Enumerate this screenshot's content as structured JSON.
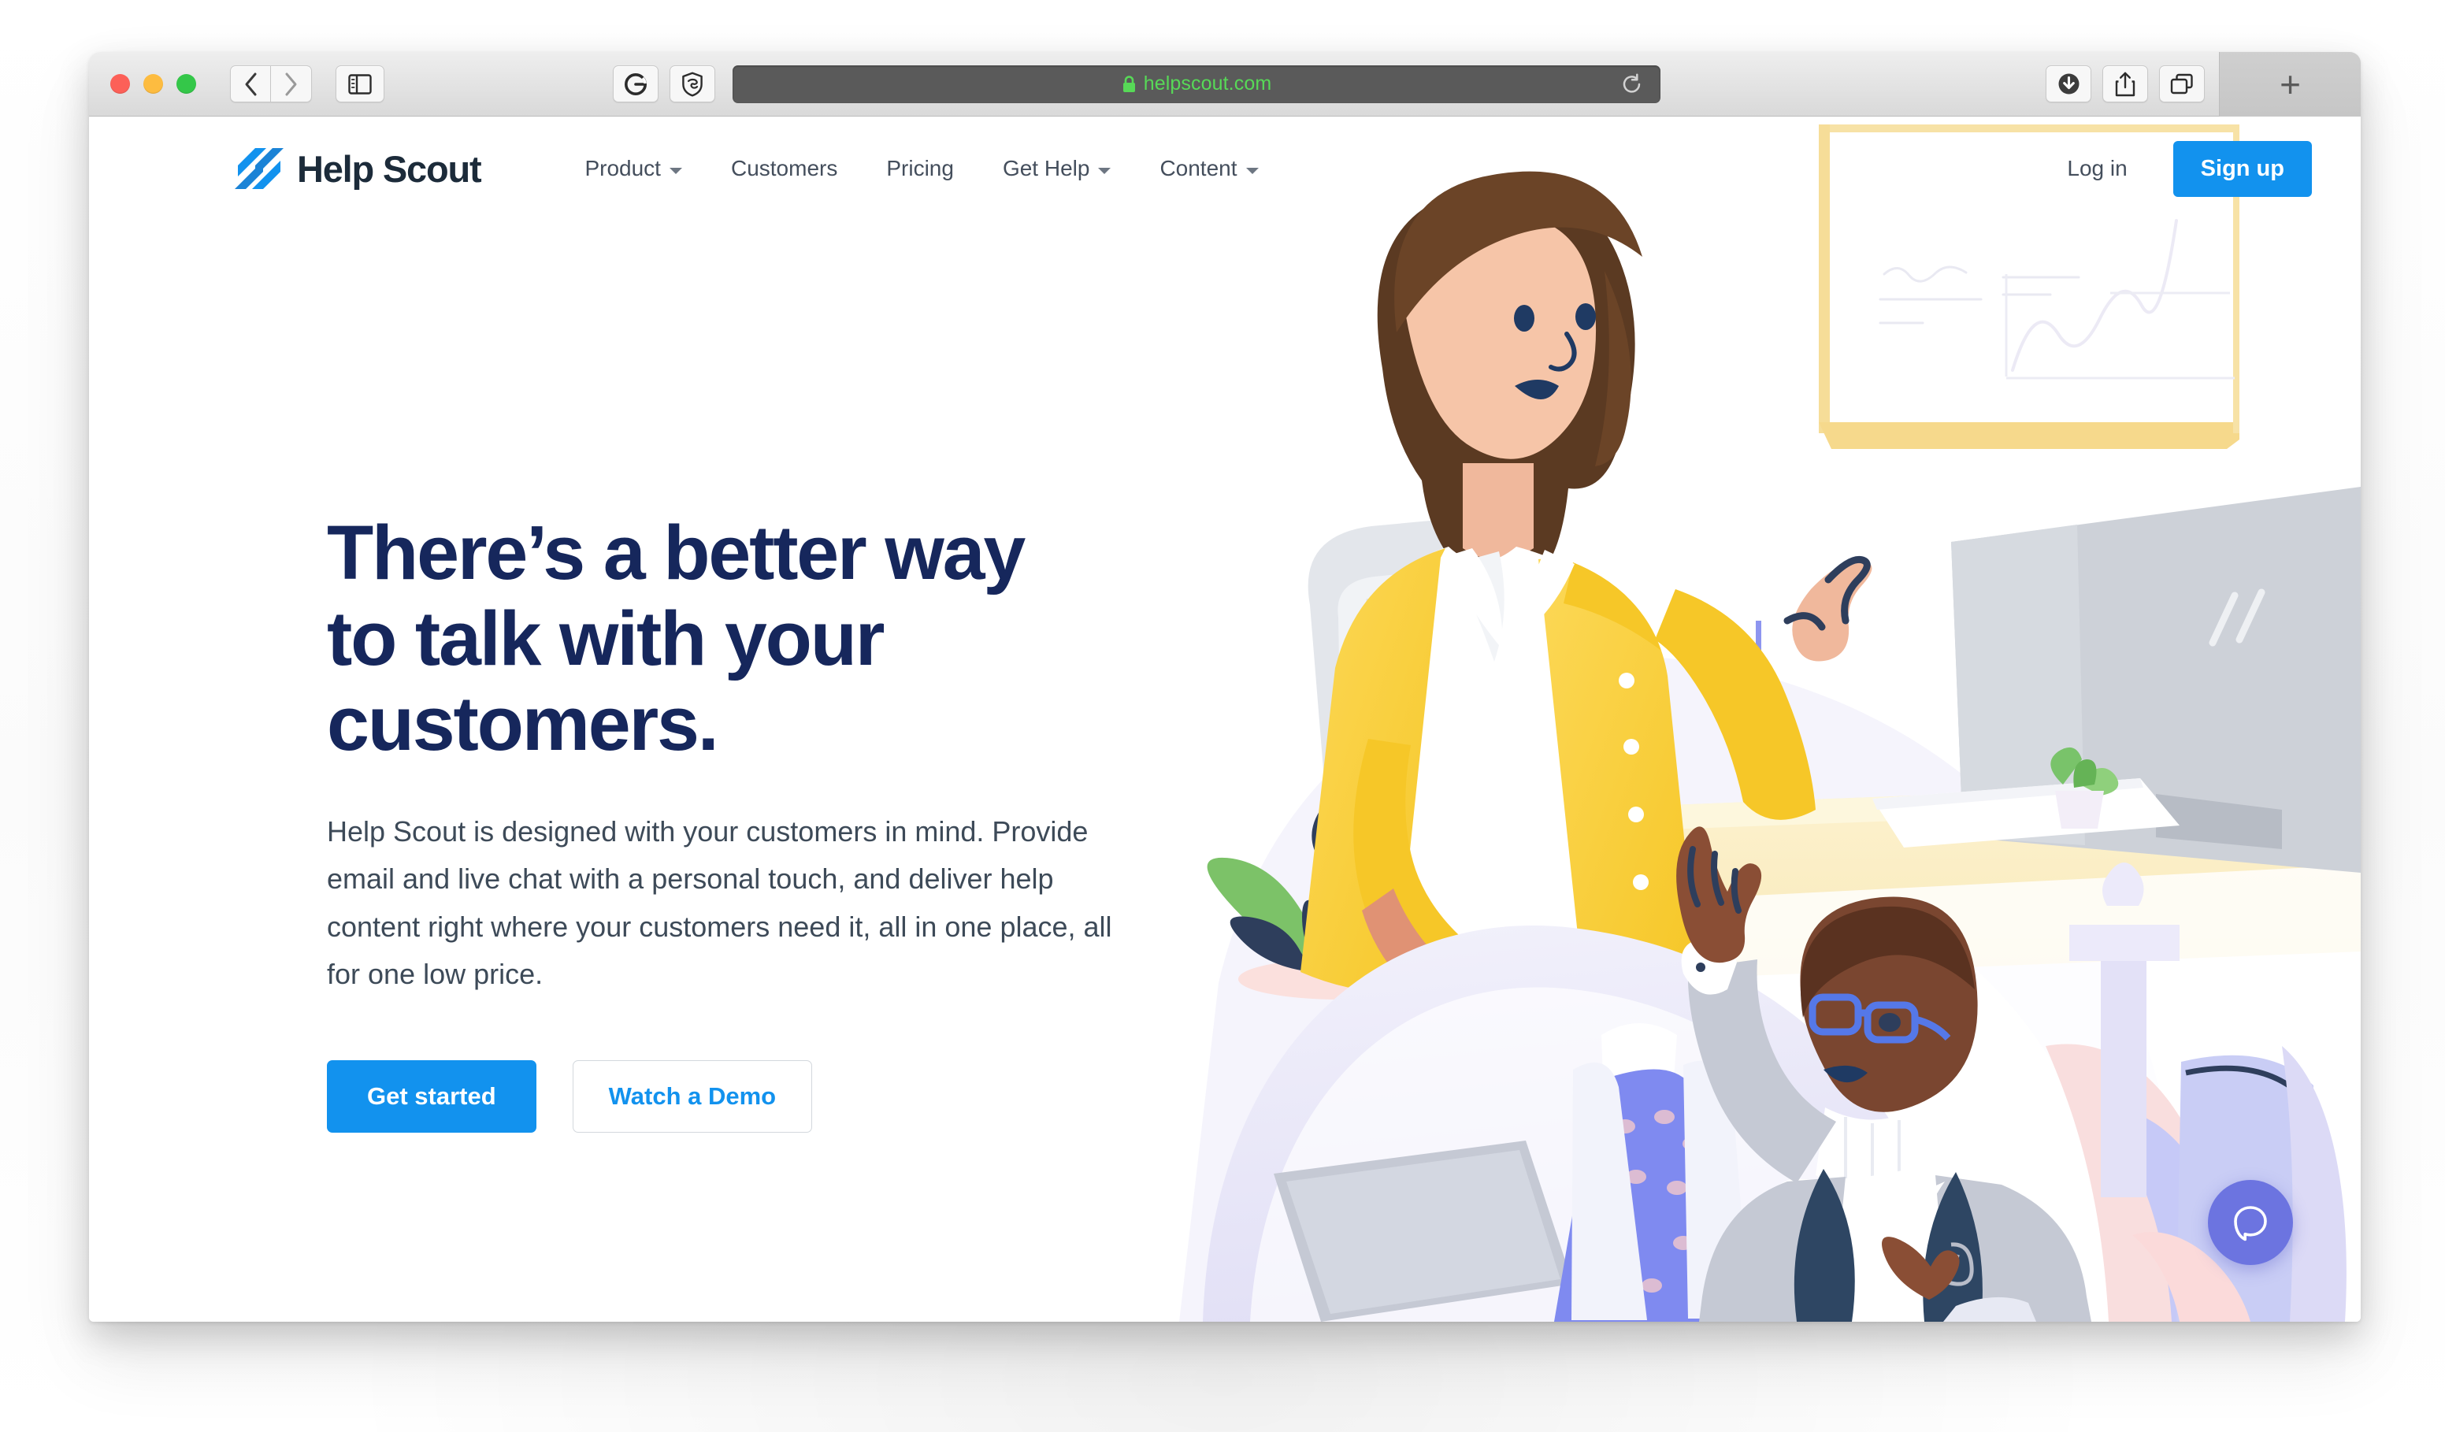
{
  "browser": {
    "traffic_lights": [
      "close",
      "minimize",
      "maximize"
    ],
    "back_label": "Back",
    "forward_label": "Forward",
    "sidebar_label": "Show sidebar",
    "extensions": [
      {
        "name": "grammarly-icon",
        "label": "Grammarly"
      },
      {
        "name": "shield-icon",
        "label": "Privacy shield"
      }
    ],
    "url": "helpscout.com",
    "url_secure": true,
    "reload_label": "Reload",
    "right_buttons": [
      {
        "name": "downloads-icon",
        "label": "Downloads"
      },
      {
        "name": "share-icon",
        "label": "Share"
      },
      {
        "name": "tab-overview-icon",
        "label": "Tab Overview"
      }
    ],
    "new_tab_label": "+"
  },
  "site": {
    "brand": {
      "name": "Help Scout",
      "mark_color": "#1292ee",
      "text_color": "#1c2b3a"
    },
    "nav": [
      {
        "label": "Product",
        "has_menu": true
      },
      {
        "label": "Customers",
        "has_menu": false
      },
      {
        "label": "Pricing",
        "has_menu": false
      },
      {
        "label": "Get Help",
        "has_menu": true
      },
      {
        "label": "Content",
        "has_menu": true
      }
    ],
    "login_label": "Log in",
    "signup_label": "Sign up",
    "hero": {
      "title_line_1": "There’s a better way",
      "title_line_2": "to talk with your",
      "title_line_3": "customers.",
      "subtitle": "Help Scout is designed with your customers in mind. Provide email and live chat with a personal touch, and deliver help content right where your customers need it, all in one place, all for one low price.",
      "primary_cta": "Get started",
      "secondary_cta": "Watch a Demo"
    },
    "chat_widget": {
      "label": "Open chat",
      "color": "#6c74e0"
    },
    "colors": {
      "accent_blue": "#1292ee",
      "headline_navy": "#16275c",
      "body_text": "#3d4a58",
      "chat_purple": "#6c74e0",
      "url_green": "#57d957"
    }
  }
}
